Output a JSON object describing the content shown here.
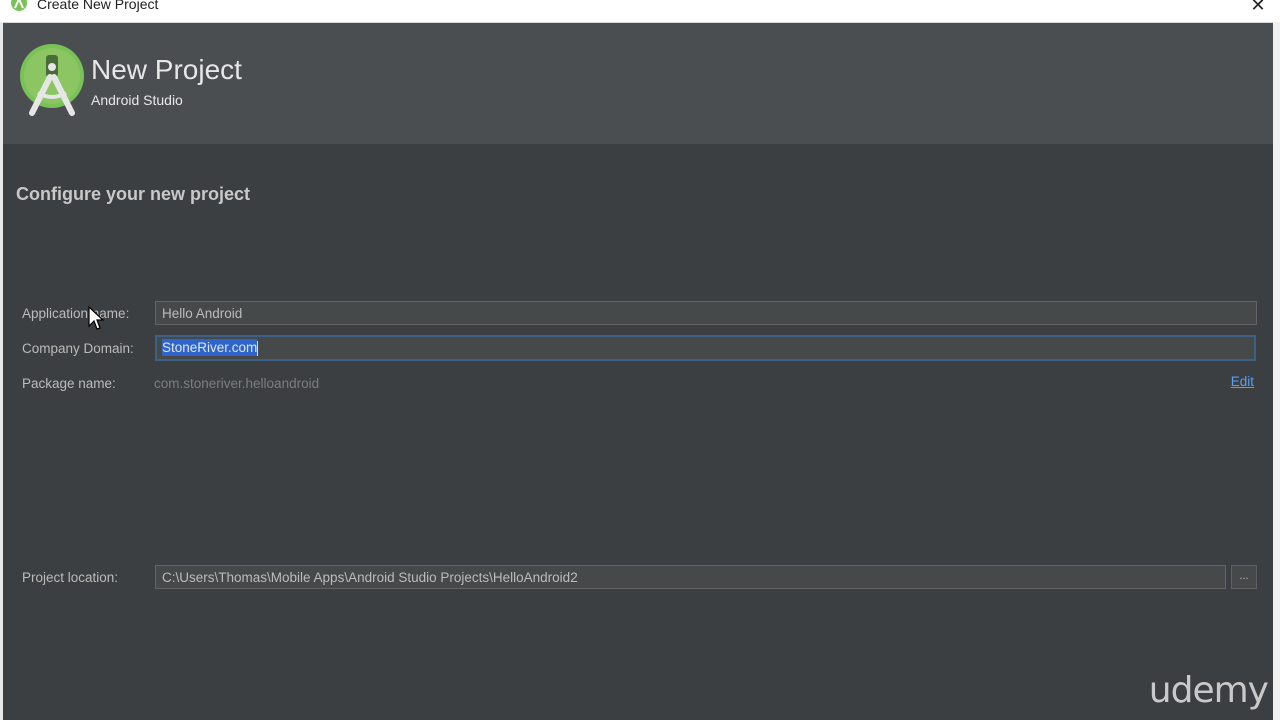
{
  "window": {
    "title": "Create New Project",
    "close_glyph": "✕"
  },
  "header": {
    "title": "New Project",
    "subtitle": "Android Studio",
    "logo_icon": "android-studio-logo"
  },
  "section": {
    "title": "Configure your new project"
  },
  "form": {
    "app_name": {
      "label": "Application name:",
      "value": "Hello Android"
    },
    "company_domain": {
      "label": "Company Domain:",
      "value": "StoneRiver.com"
    },
    "package_name": {
      "label": "Package name:",
      "value": "com.stoneriver.helloandroid",
      "edit_label": "Edit"
    },
    "project_location": {
      "label": "Project location:",
      "value": "C:\\Users\\Thomas\\Mobile Apps\\Android Studio Projects\\HelloAndroid2",
      "browse_label": "..."
    }
  },
  "watermark": "udemy",
  "colors": {
    "background": "#3c3f41",
    "header": "#4b4e50",
    "link": "#589df6",
    "selection": "#2f65ca"
  }
}
